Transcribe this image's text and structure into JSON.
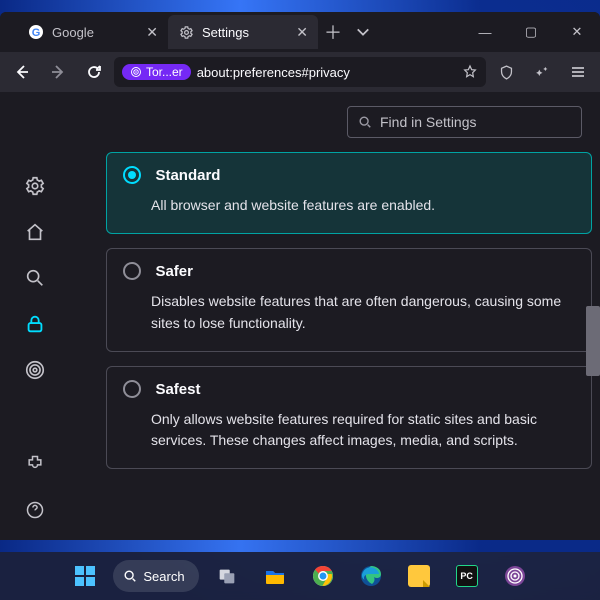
{
  "window": {
    "tabs": [
      {
        "label": "Google",
        "icon": "G"
      },
      {
        "label": "Settings",
        "icon": "gear"
      }
    ],
    "controls": {
      "min": "—",
      "max": "▢",
      "close": "✕"
    }
  },
  "toolbar": {
    "badge": "Tor...er",
    "url": "about:preferences#privacy"
  },
  "settings": {
    "find_placeholder": "Find in Settings",
    "levels": [
      {
        "title": "Standard",
        "desc": "All browser and website features are enabled.",
        "selected": true
      },
      {
        "title": "Safer",
        "desc": "Disables website features that are often dangerous, causing some sites to lose functionality.",
        "selected": false
      },
      {
        "title": "Safest",
        "desc": "Only allows website features required for static sites and basic services. These changes affect images, media, and scripts.",
        "selected": false
      }
    ]
  },
  "taskbar": {
    "search": "Search"
  }
}
